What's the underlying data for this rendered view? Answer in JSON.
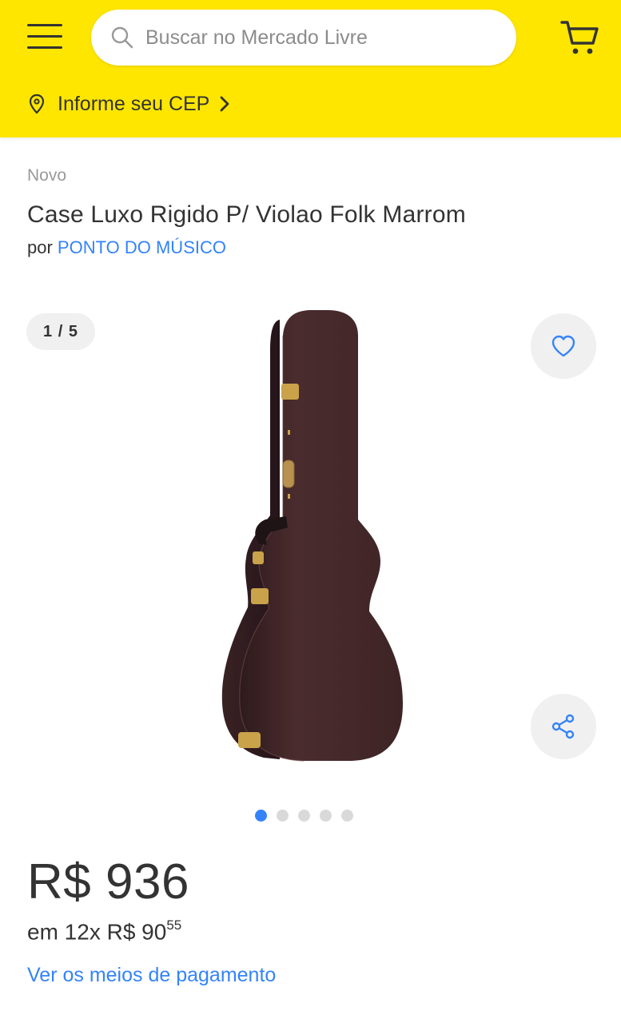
{
  "header": {
    "background_color": "#ffe600",
    "menu_icon": "hamburger-menu-icon",
    "search": {
      "placeholder": "Buscar no Mercado Livre",
      "value": "",
      "icon": "search-icon"
    },
    "cart_icon": "cart-icon",
    "cep": {
      "label": "Informe seu CEP",
      "icon": "location-pin-icon",
      "chevron": "chevron-right-icon"
    }
  },
  "product": {
    "condition": "Novo",
    "title": "Case Luxo Rigido P/ Violao Folk Marrom",
    "seller_prefix": "por",
    "seller_name": "PONTO DO MÚSICO",
    "gallery": {
      "counter": "1 / 5",
      "current": 1,
      "total": 5
    },
    "price": "R$ 936",
    "installments_prefix": "em 12x R$ 90",
    "installments_cents": "55",
    "payment_link": "Ver os meios de pagamento"
  },
  "colors": {
    "accent_blue": "#3483fa",
    "case_brown": "#4a2c2e"
  }
}
